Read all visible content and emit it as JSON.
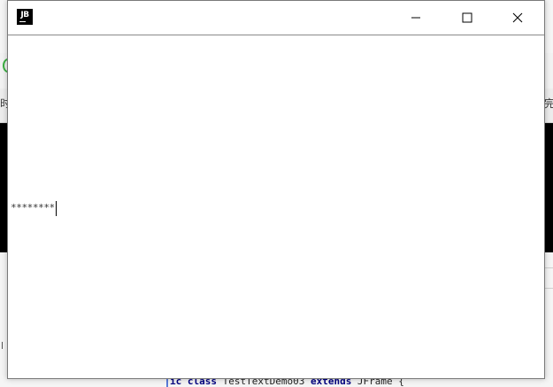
{
  "window": {
    "app_icon_text": "JB",
    "password_field": {
      "masked_value": "********"
    }
  },
  "background": {
    "left_glyph": "时",
    "right_glyph": "完",
    "code_line": {
      "kw1": "ic class",
      "name": " TestTextDemo03 ",
      "kw2": "extends",
      "rest": " JFrame {"
    }
  }
}
